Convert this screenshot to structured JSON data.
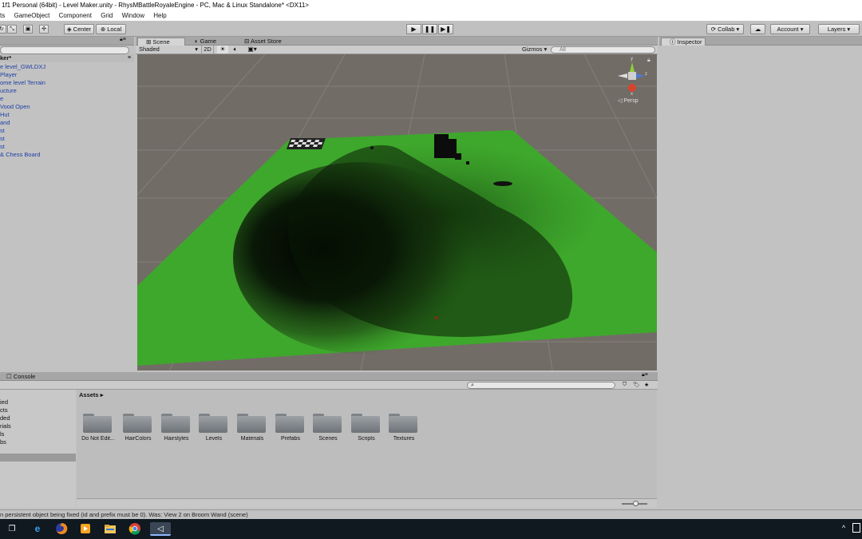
{
  "window": {
    "title": "1f1 Personal (64bit) - Level Maker.unity - RhysMBattleRoyaleEngine - PC, Mac & Linux Standalone* <DX11>"
  },
  "menu": [
    "ts",
    "GameObject",
    "Component",
    "Grid",
    "Window",
    "Help"
  ],
  "toolbar": {
    "pivot_label": "Center",
    "space_label": "Local",
    "collab_label": "Collab",
    "account_label": "Account",
    "layers_label": "Layers"
  },
  "hierarchy": {
    "header": "ker*",
    "items": [
      "e level_GWLDXJ",
      "Player",
      "ome level Terrain",
      "ucture",
      "e",
      "Vood Open",
      "Hut",
      "and",
      "st",
      "st",
      "st",
      "& Chess Board"
    ]
  },
  "scene": {
    "tabs": [
      "Scene",
      "Game",
      "Asset Store"
    ],
    "shading": "Shaded",
    "mode_2d": "2D",
    "gizmos_label": "Gizmos",
    "search_placeholder": "All",
    "persp_label": "Persp",
    "axis_y": "y",
    "axis_z": "z",
    "axis_x": "x",
    "colors": {
      "sky": "#726c67",
      "ground": "#3ea82c"
    }
  },
  "inspector": {
    "tab": "Inspector"
  },
  "project": {
    "console_tab": "Console",
    "breadcrumb": "Assets",
    "left_items": [
      "ied",
      "cts",
      "ded",
      "rials",
      "ls",
      "bs"
    ],
    "folders": [
      "Do Not Edit...",
      "HairColors",
      "Hairstyles",
      "Levels",
      "Materials",
      "Prefabs",
      "Scenes",
      "Scripts",
      "Textures"
    ]
  },
  "status": {
    "message": "n persistent object being fixed (id and prefix must be 0). Was: View 2 on Broom Wand (scene)"
  },
  "taskbar": {
    "icons": [
      "task-view-icon",
      "edge-icon",
      "firefox-icon",
      "media-player-icon",
      "file-explorer-icon",
      "chrome-icon",
      "unity-icon"
    ]
  }
}
